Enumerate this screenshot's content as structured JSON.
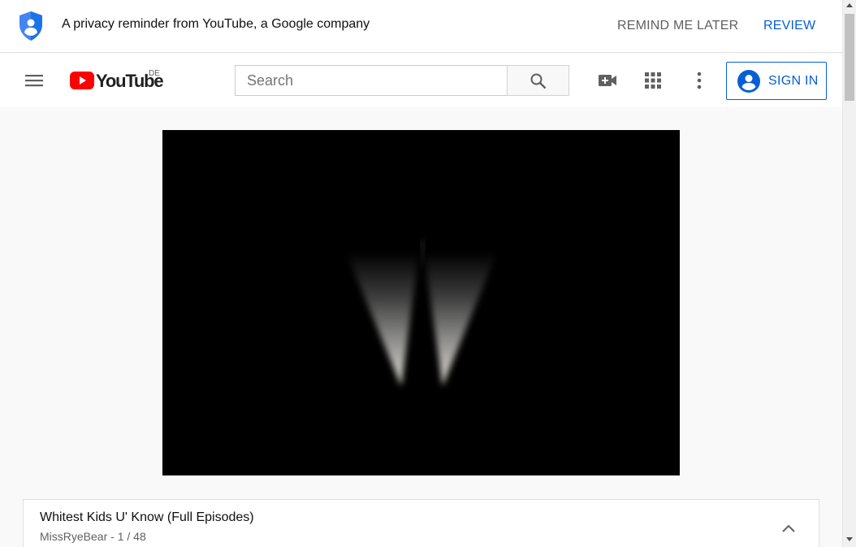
{
  "privacy_banner": {
    "icon": "shield-user-icon",
    "text": "A privacy reminder from YouTube, a Google company",
    "remind_later_label": "REMIND ME LATER",
    "review_label": "REVIEW"
  },
  "masthead": {
    "menu_icon": "hamburger-menu-icon",
    "logo": {
      "wordmark": "YouTube",
      "country_code": "DE"
    },
    "search": {
      "placeholder": "Search",
      "value": ""
    },
    "search_icon": "search-icon",
    "upload_icon": "video-camera-plus-icon",
    "apps_icon": "apps-grid-icon",
    "settings_icon": "more-vertical-icon",
    "sign_in_label": "SIGN IN"
  },
  "player": {
    "state": "paused"
  },
  "playlist": {
    "title": "Whitest Kids U' Know (Full Episodes)",
    "owner": "MissRyeBear",
    "separator": " - ",
    "position": "1 / 48",
    "collapse_icon": "chevron-up-icon"
  },
  "colors": {
    "accent_blue": "#065fd4",
    "youtube_red": "#ff0000",
    "background": "#f9f9f9",
    "shield_blue": "#4285f4"
  }
}
